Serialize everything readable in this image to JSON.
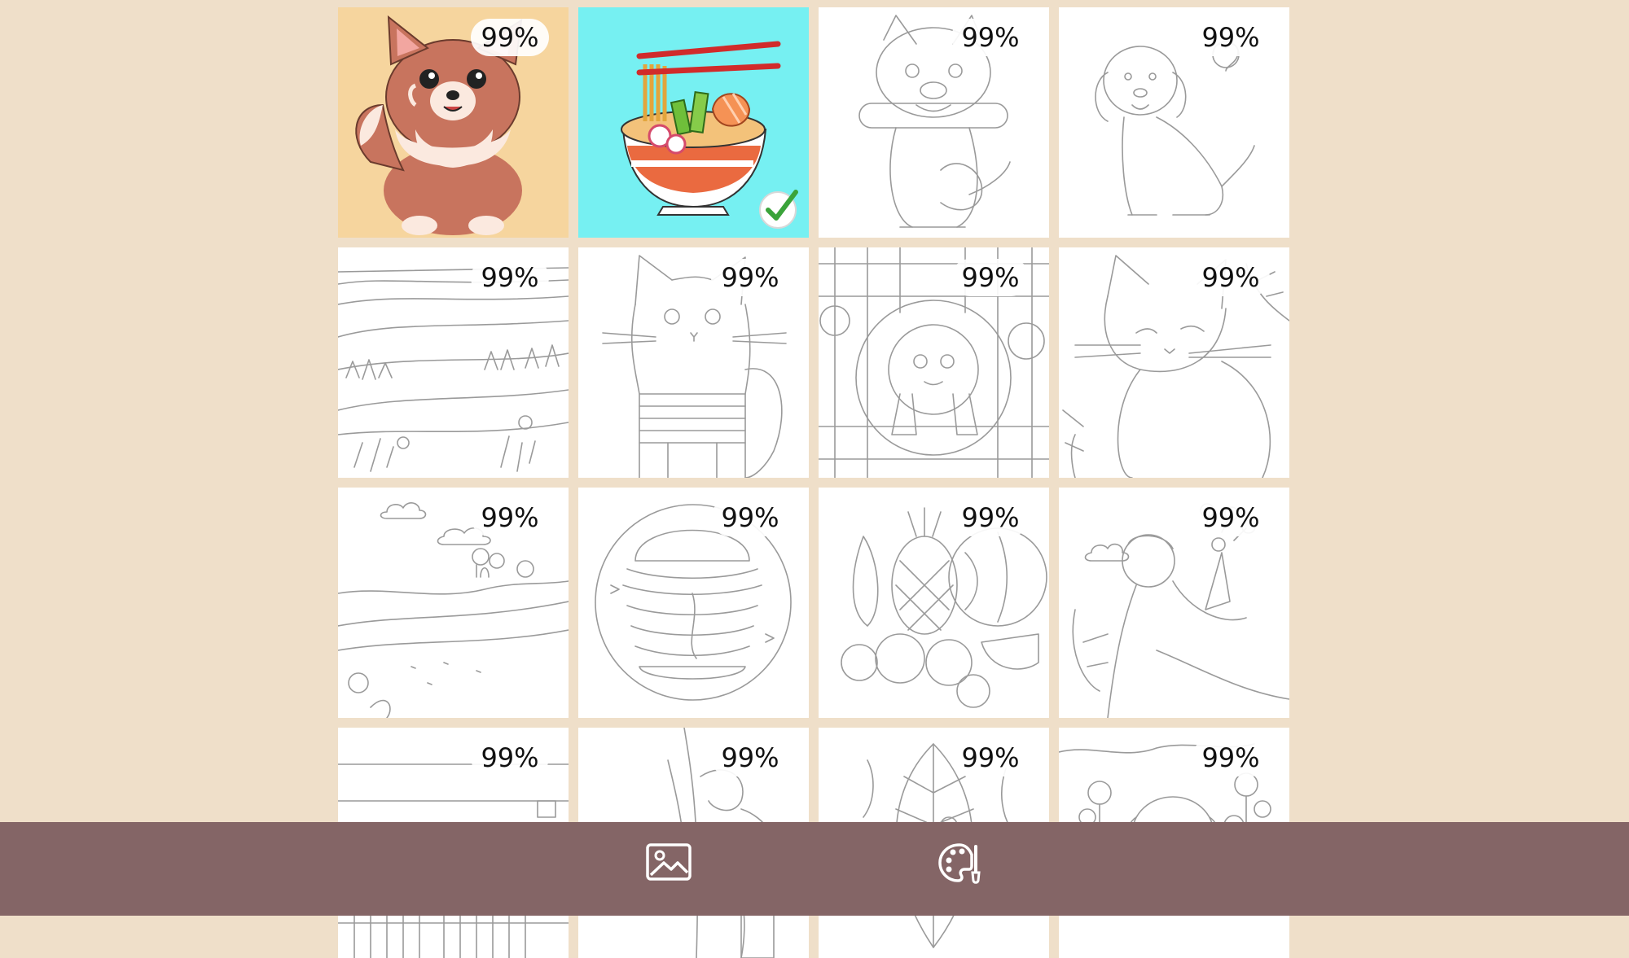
{
  "gallery": {
    "cards": [
      {
        "id": "corgi",
        "art": "corgi",
        "progress_label": "99%",
        "completed": false,
        "bg": "#f6d59e"
      },
      {
        "id": "ramen",
        "art": "ramen",
        "progress_label": "",
        "completed": true,
        "bg": "#76f0f2"
      },
      {
        "id": "bulldog",
        "art": "bulldog",
        "progress_label": "99%",
        "completed": false,
        "bg": "#ffffff"
      },
      {
        "id": "puppy",
        "art": "puppy",
        "progress_label": "99%",
        "completed": false,
        "bg": "#ffffff"
      },
      {
        "id": "landscape-hills",
        "art": "landscape",
        "progress_label": "99%",
        "completed": false,
        "bg": "#ffffff"
      },
      {
        "id": "striped-cat",
        "art": "cat-stripes",
        "progress_label": "99%",
        "completed": false,
        "bg": "#ffffff"
      },
      {
        "id": "poodle-window",
        "art": "poodle",
        "progress_label": "99%",
        "completed": false,
        "bg": "#ffffff"
      },
      {
        "id": "cat-leaves",
        "art": "cat-leaves",
        "progress_label": "99%",
        "completed": false,
        "bg": "#ffffff"
      },
      {
        "id": "field-clouds",
        "art": "field",
        "progress_label": "99%",
        "completed": false,
        "bg": "#ffffff"
      },
      {
        "id": "burger",
        "art": "burger",
        "progress_label": "99%",
        "completed": false,
        "bg": "#ffffff"
      },
      {
        "id": "fruits",
        "art": "fruits",
        "progress_label": "99%",
        "completed": false,
        "bg": "#ffffff"
      },
      {
        "id": "flowers-woman",
        "art": "woman",
        "progress_label": "99%",
        "completed": false,
        "bg": "#ffffff"
      },
      {
        "id": "building",
        "art": "building",
        "progress_label": "99%",
        "completed": false,
        "bg": "#ffffff"
      },
      {
        "id": "plants",
        "art": "plants",
        "progress_label": "99%",
        "completed": false,
        "bg": "#ffffff"
      },
      {
        "id": "leaf",
        "art": "leaf",
        "progress_label": "99%",
        "completed": false,
        "bg": "#ffffff"
      },
      {
        "id": "dog-flowers",
        "art": "dog-flowers",
        "progress_label": "99%",
        "completed": false,
        "bg": "#ffffff"
      }
    ]
  },
  "bottom_nav": {
    "background": "#846566",
    "items": [
      {
        "name": "gallery-nav-button",
        "icon": "image-icon"
      },
      {
        "name": "palette-nav-button",
        "icon": "palette-brush-icon"
      }
    ]
  },
  "colors": {
    "page_bg": "#efdfc9",
    "check": "#3aa33a"
  }
}
